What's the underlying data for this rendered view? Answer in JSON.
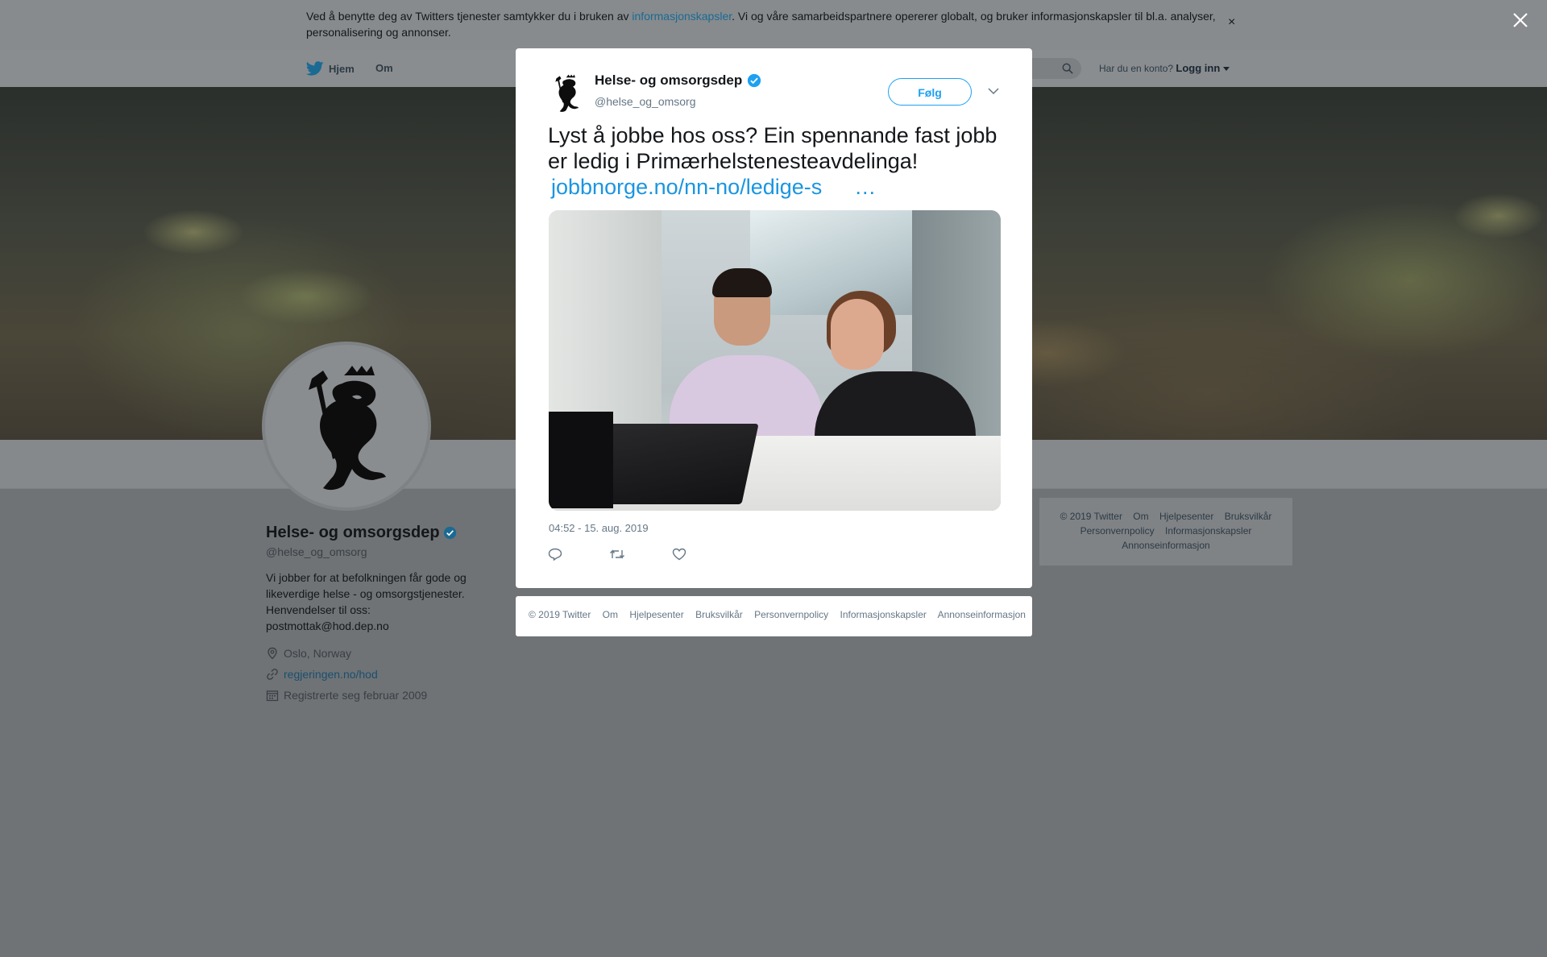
{
  "cookie_banner": {
    "text_before": "Ved å benytte deg av Twitters tjenester samtykker du i bruken av ",
    "link": "informasjonskapsler",
    "text_after": ". Vi og våre samarbeidspartnere opererer globalt, og bruker informasjonskapsler til bl.a. analyser, personalisering og annonser.",
    "close": "×"
  },
  "nav": {
    "home": "Hjem",
    "about": "Om",
    "has_account": "Har du en konto?",
    "login": "Logg inn"
  },
  "profile": {
    "name": "Helse- og omsorgsdep",
    "handle": "@helse_og_omsorg",
    "bio": "Vi jobber for at befolkningen får gode og likeverdige helse - og omsorgstjenester. Henvendelser til oss: postmottak@hod.dep.no",
    "location": "Oslo, Norway",
    "website": "regjeringen.no/hod",
    "joined": "Registrerte seg februar 2009"
  },
  "side_footer": {
    "items": [
      "© 2019 Twitter",
      "Om",
      "Hjelpesenter",
      "Bruksvilkår",
      "Personvernpolicy",
      "Informasjonskapsler",
      "Annonseinformasjon"
    ]
  },
  "tweet": {
    "name": "Helse- og omsorgsdep",
    "handle": "@helse_og_omsorg",
    "follow": "Følg",
    "text": "Lyst å jobbe hos oss? Ein spennande fast jobb er ledig i Primærhelstenesteavdelinga!",
    "link": "jobbnorge.no/nn-no/ledige-s",
    "ellipsis": "…",
    "timestamp": "04:52 - 15. aug. 2019"
  },
  "modal_footer": {
    "items": [
      "© 2019 Twitter",
      "Om",
      "Hjelpesenter",
      "Bruksvilkår",
      "Personvernpolicy",
      "Informasjonskapsler",
      "Annonseinformasjon"
    ]
  },
  "colors": {
    "accent": "#1da1f2",
    "link": "#1b95e0",
    "overlay_bg": "#6f7376",
    "verified": "#1da1f2"
  },
  "icons": [
    "twitter-bird-icon",
    "search-icon",
    "caret-down-icon",
    "verified-icon",
    "location-icon",
    "link-icon",
    "calendar-icon",
    "chevron-down-icon",
    "reply-icon",
    "retweet-icon",
    "like-icon",
    "close-icon"
  ]
}
